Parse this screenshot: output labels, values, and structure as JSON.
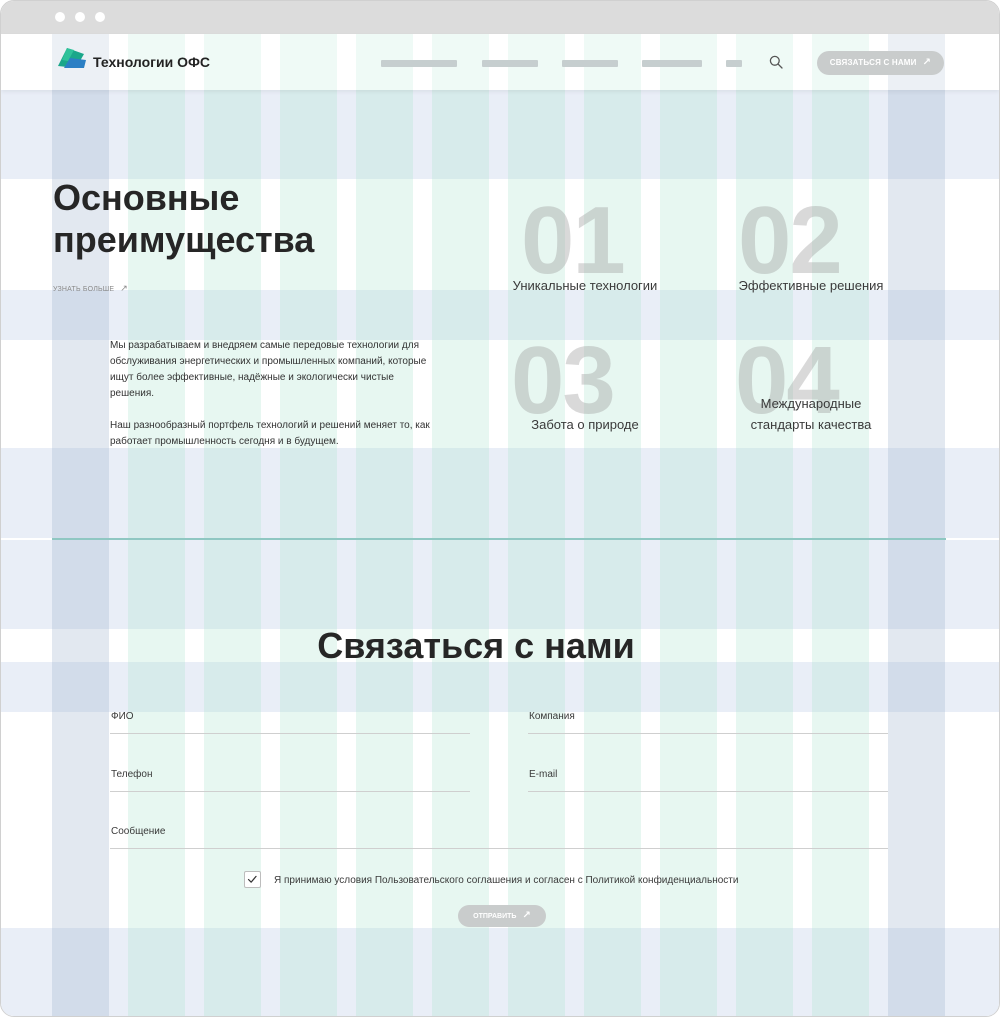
{
  "browser": {
    "window_controls": [
      "close",
      "minimize",
      "maximize"
    ]
  },
  "header": {
    "logo_text": "Технологии ОФС",
    "logo_colors": [
      "#1aa78a",
      "#2b7fc4"
    ],
    "nav_item_count": 5,
    "search_icon": "search-icon",
    "contact_button": "СВЯЗАТЬСЯ С НАМИ"
  },
  "advantages": {
    "title": "Основные преимущества",
    "more_link": "УЗНАТЬ БОЛЬШЕ",
    "paragraph1": "Мы разрабатываем и внедряем самые передовые технологии для обслуживания энергетических и промышленных компаний, которые ищут более эффективные, надёжные и экологически чистые решения.",
    "paragraph2": "Наш разнообразный портфель технологий и решений меняет то, как работает промышленность сегодня и в будущем.",
    "items": [
      {
        "number": "01",
        "label": "Уникальные технологии"
      },
      {
        "number": "02",
        "label": "Эффективные решения"
      },
      {
        "number": "03",
        "label": "Забота о природе"
      },
      {
        "number": "04",
        "label": "Международные стандарты качества"
      }
    ]
  },
  "contact": {
    "title": "Связаться с нами",
    "fields": {
      "name": "ФИО",
      "company": "Компания",
      "phone": "Телефон",
      "email": "E-mail",
      "message": "Сообщение"
    },
    "consent_checked": true,
    "consent_text": "Я принимаю условия Пользовательского соглашения и согласен с Политикой конфиденциальности",
    "submit_label": "ОТПРАВИТЬ"
  },
  "colors": {
    "accent_teal": "#1aa78a",
    "divider": "#8fc7c2",
    "button_gray": "#c9cccc",
    "grid_blue": "#a0b4cd",
    "grid_mint": "#afe6d2"
  }
}
